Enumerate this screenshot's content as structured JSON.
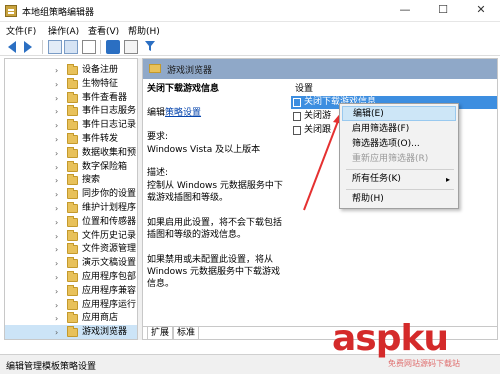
{
  "window": {
    "title": "本地组策略编辑器",
    "controls": [
      "—",
      "☐",
      "✕"
    ]
  },
  "menu": [
    "文件(F)",
    "操作(A)",
    "查看(V)",
    "帮助(H)"
  ],
  "tree": {
    "items": [
      {
        "label": "设备注册"
      },
      {
        "label": "生物特征"
      },
      {
        "label": "事件查看器"
      },
      {
        "label": "事件日志服务"
      },
      {
        "label": "事件日志记录"
      },
      {
        "label": "事件转发"
      },
      {
        "label": "数据收集和预"
      },
      {
        "label": "数字保险箱"
      },
      {
        "label": "搜索"
      },
      {
        "label": "同步你的设置"
      },
      {
        "label": "维护计划程序"
      },
      {
        "label": "位置和传感器"
      },
      {
        "label": "文件历史记录"
      },
      {
        "label": "文件资源管理"
      },
      {
        "label": "演示文稿设置"
      },
      {
        "label": "应用程序包部"
      },
      {
        "label": "应用程序兼容"
      },
      {
        "label": "应用程序运行"
      },
      {
        "label": "应用商店"
      },
      {
        "label": "游戏浏览器",
        "selected": true
      }
    ]
  },
  "rightpane": {
    "header": "游戏浏览器",
    "policy_title": "关闭下载游戏信息",
    "edit_prefix": "编辑",
    "edit_link": "策略设置",
    "req_label": "要求:",
    "req_value": "Windows Vista 及以上版本",
    "desc_label": "描述:",
    "desc_text": "控制从 Windows 元数据服务中下载游戏插图和等级。",
    "enabled_text": "如果启用此设置，将不会下载包括插图和等级的游戏信息。",
    "disabled_text": "如果禁用或未配置此设置，将从 Windows 元数据服务中下载游戏信息。",
    "settings_header": "设置",
    "settings": [
      {
        "label": "关闭下载游戏信息",
        "selected": true
      },
      {
        "label": "关闭游"
      },
      {
        "label": "关闭跟"
      }
    ],
    "tabs": [
      "扩展",
      "标准"
    ]
  },
  "context_menu": {
    "items": [
      {
        "label": "编辑(E)",
        "highlight": true
      },
      {
        "label": "启用筛选器(F)"
      },
      {
        "label": "筛选器选项(O)..."
      },
      {
        "label": "重新应用筛选器(R)",
        "disabled": true
      },
      {
        "label": "所有任务(K)",
        "submenu": true
      },
      {
        "label": "帮助(H)"
      }
    ]
  },
  "statusbar": {
    "text": "编辑管理模板策略设置"
  },
  "watermark": {
    "main": "aspku",
    "sub": "免费网站源码下载站"
  }
}
